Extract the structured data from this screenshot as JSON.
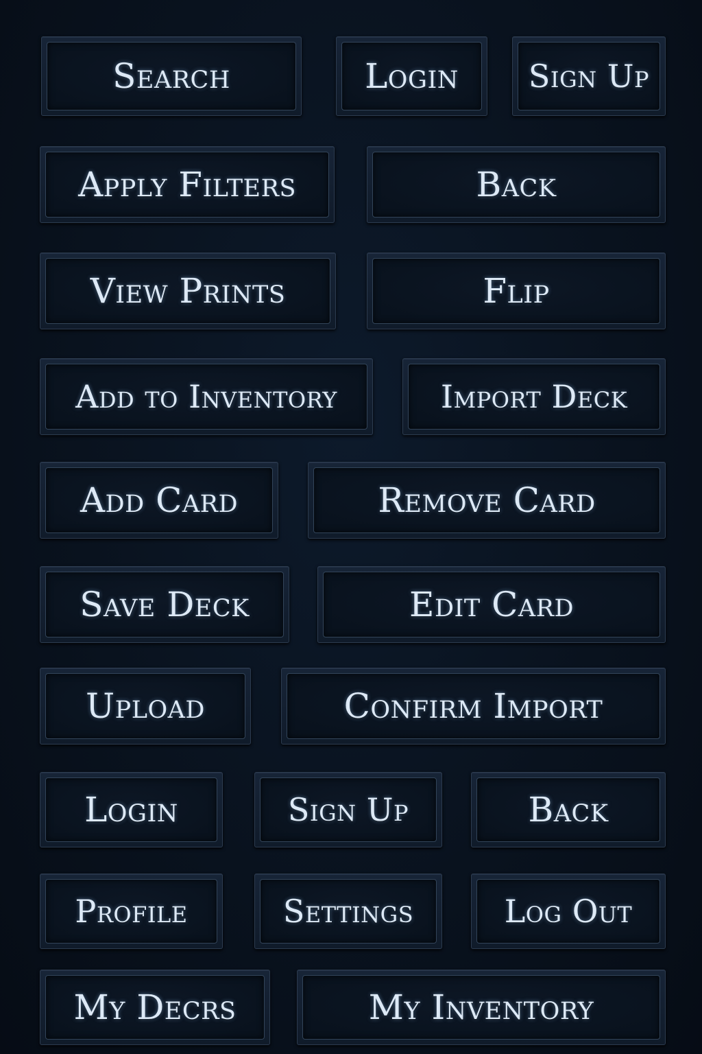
{
  "buttons": [
    {
      "label": "Search"
    },
    {
      "label": "Login"
    },
    {
      "label": "Sign Up"
    },
    {
      "label": "Apply Filters"
    },
    {
      "label": "Back"
    },
    {
      "label": "View Prints"
    },
    {
      "label": "Flip"
    },
    {
      "label": "Add to Inventory"
    },
    {
      "label": "Import Deck"
    },
    {
      "label": "Add Card"
    },
    {
      "label": "Remove Card"
    },
    {
      "label": "Save Deck"
    },
    {
      "label": "Edit Card"
    },
    {
      "label": "Upload"
    },
    {
      "label": "Confirm Import"
    },
    {
      "label": "Login"
    },
    {
      "label": "Sign Up"
    },
    {
      "label": "Back"
    },
    {
      "label": "Profile"
    },
    {
      "label": "Settings"
    },
    {
      "label": "Log Out"
    },
    {
      "label": "My Decrs"
    },
    {
      "label": "My Inventory"
    }
  ],
  "colors": {
    "background": "#09121e",
    "button_face": "#0d1725",
    "button_border": "#324459",
    "label_text": "#dde9f6",
    "label_glow": "#8cb9e6"
  }
}
